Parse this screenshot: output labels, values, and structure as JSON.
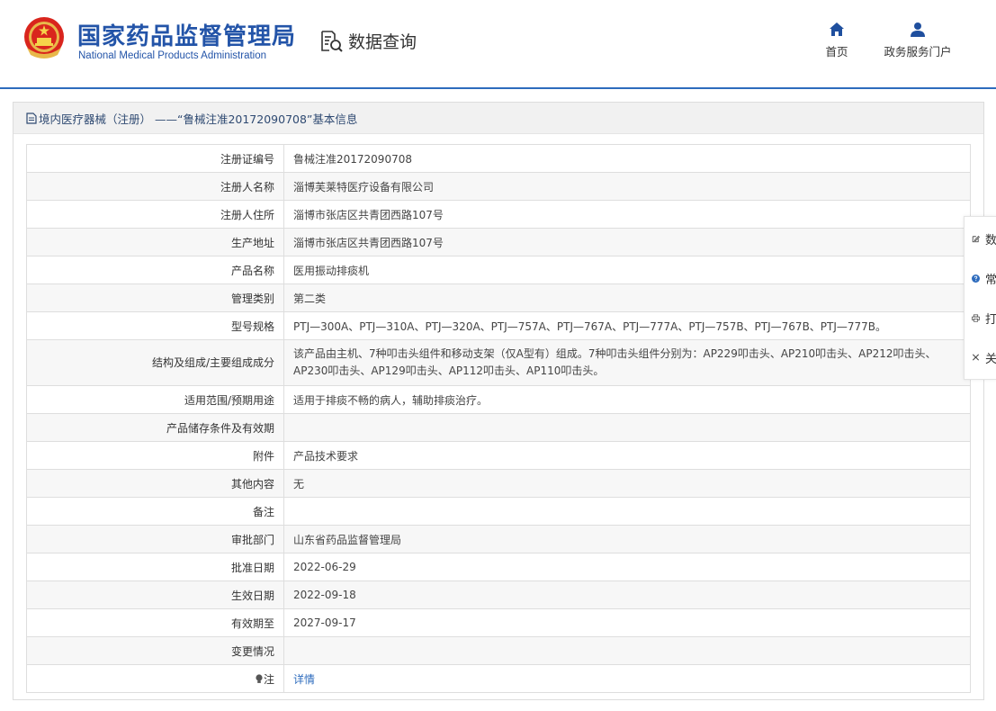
{
  "header": {
    "title_cn": "国家药品监督管理局",
    "title_en": "National Medical Products Administration",
    "query_label": "数据查询",
    "nav": {
      "home": "首页",
      "gov_portal": "政务服务门户"
    }
  },
  "panel": {
    "title": "境内医疗器械（注册） ——“鲁械注准20172090708”基本信息"
  },
  "rows": [
    {
      "label": "注册证编号",
      "value": "鲁械注准20172090708"
    },
    {
      "label": "注册人名称",
      "value": "淄博芙莱特医疗设备有限公司"
    },
    {
      "label": "注册人住所",
      "value": "淄博市张店区共青团西路107号"
    },
    {
      "label": "生产地址",
      "value": "淄博市张店区共青团西路107号"
    },
    {
      "label": "产品名称",
      "value": "医用振动排痰机"
    },
    {
      "label": "管理类别",
      "value": "第二类"
    },
    {
      "label": "型号规格",
      "value": "PTJ—300A、PTJ—310A、PTJ—320A、PTJ—757A、PTJ—767A、PTJ—777A、PTJ—757B、PTJ—767B、PTJ—777B。"
    },
    {
      "label": "结构及组成/主要组成成分",
      "value": "该产品由主机、7种叩击头组件和移动支架（仅A型有）组成。7种叩击头组件分别为：AP229叩击头、AP210叩击头、AP212叩击头、AP230叩击头、AP129叩击头、AP112叩击头、AP110叩击头。"
    },
    {
      "label": "适用范围/预期用途",
      "value": "适用于排痰不畅的病人，辅助排痰治疗。"
    },
    {
      "label": "产品储存条件及有效期",
      "value": ""
    },
    {
      "label": "附件",
      "value": "产品技术要求"
    },
    {
      "label": "其他内容",
      "value": "无"
    },
    {
      "label": "备注",
      "value": ""
    },
    {
      "label": "审批部门",
      "value": "山东省药品监督管理局"
    },
    {
      "label": "批准日期",
      "value": "2022-06-29"
    },
    {
      "label": "生效日期",
      "value": "2022-09-18"
    },
    {
      "label": "有效期至",
      "value": "2027-09-17"
    },
    {
      "label": "变更情况",
      "value": ""
    },
    {
      "label": "注",
      "value": "详情"
    }
  ],
  "float_toolbar": {
    "items": [
      {
        "icon": "edit-icon",
        "label": "数"
      },
      {
        "icon": "help-circle-icon",
        "label": "常"
      },
      {
        "icon": "printer-icon",
        "label": "打"
      },
      {
        "icon": "close-icon",
        "label": "关"
      }
    ]
  },
  "colors": {
    "brand": "#2354a8",
    "accent": "#2d6bbd",
    "help": "#2d6bbd"
  }
}
